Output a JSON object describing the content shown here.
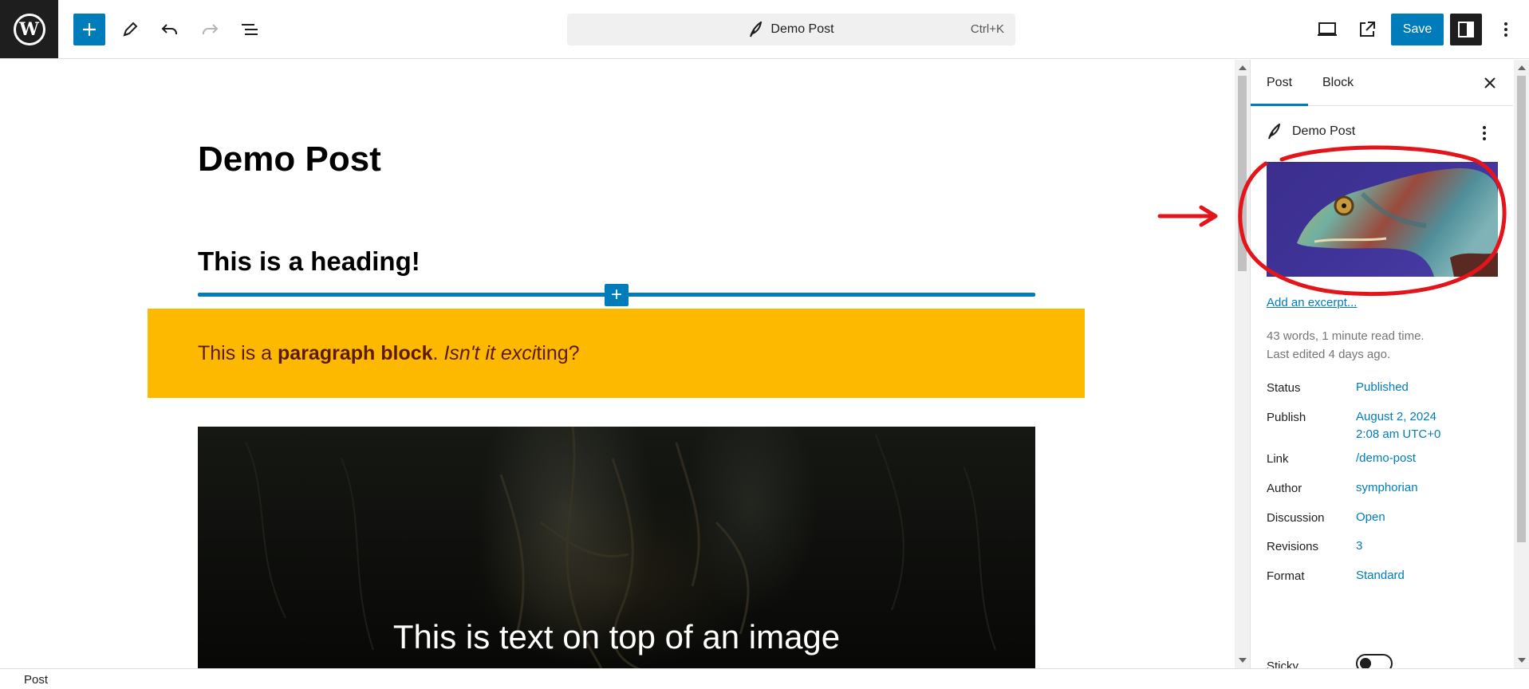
{
  "toolbar": {
    "wp_logo_letter": "W",
    "document_title": "Demo Post",
    "command_shortcut": "Ctrl+K",
    "save_label": "Save",
    "icons": [
      "add-block-icon",
      "pencil-icon",
      "undo-icon",
      "redo-icon",
      "list-view-icon",
      "feather-icon",
      "desktop-preview-icon",
      "external-view-icon",
      "sidebar-toggle-icon",
      "options-kebab-icon"
    ]
  },
  "editor": {
    "post_title": "Demo Post",
    "heading": "This is a heading!",
    "paragraph": {
      "before": "This is a ",
      "bold": "paragraph block",
      "middle": ". ",
      "italic": "Isn't it exci",
      "after": "ting?"
    },
    "paragraph_bg": "#fcb900",
    "cover_text": "This is text on top of an image"
  },
  "sidebar": {
    "tabs": [
      {
        "label": "Post",
        "active": true
      },
      {
        "label": "Block",
        "active": false
      }
    ],
    "post_title": "Demo Post",
    "excerpt_link": "Add an excerpt...",
    "meta": {
      "words": "43 words, 1 minute read time.",
      "last_edited": "Last edited 4 days ago."
    },
    "rows": [
      {
        "label": "Status",
        "value": "Published"
      },
      {
        "label": "Publish",
        "value": "August 2, 2024",
        "value2": "2:08 am UTC+0"
      },
      {
        "label": "Link",
        "value": "/demo-post"
      },
      {
        "label": "Author",
        "value": "symphorian"
      },
      {
        "label": "Discussion",
        "value": "Open"
      },
      {
        "label": "Revisions",
        "value": "3"
      },
      {
        "label": "Format",
        "value": "Standard"
      },
      {
        "label": "Sticky",
        "value": ""
      }
    ],
    "sticky_on": false
  },
  "footer": {
    "breadcrumb": "Post"
  },
  "colors": {
    "accent": "#007cba",
    "annotation": "#e3151a",
    "dark": "#1e1e1e"
  }
}
